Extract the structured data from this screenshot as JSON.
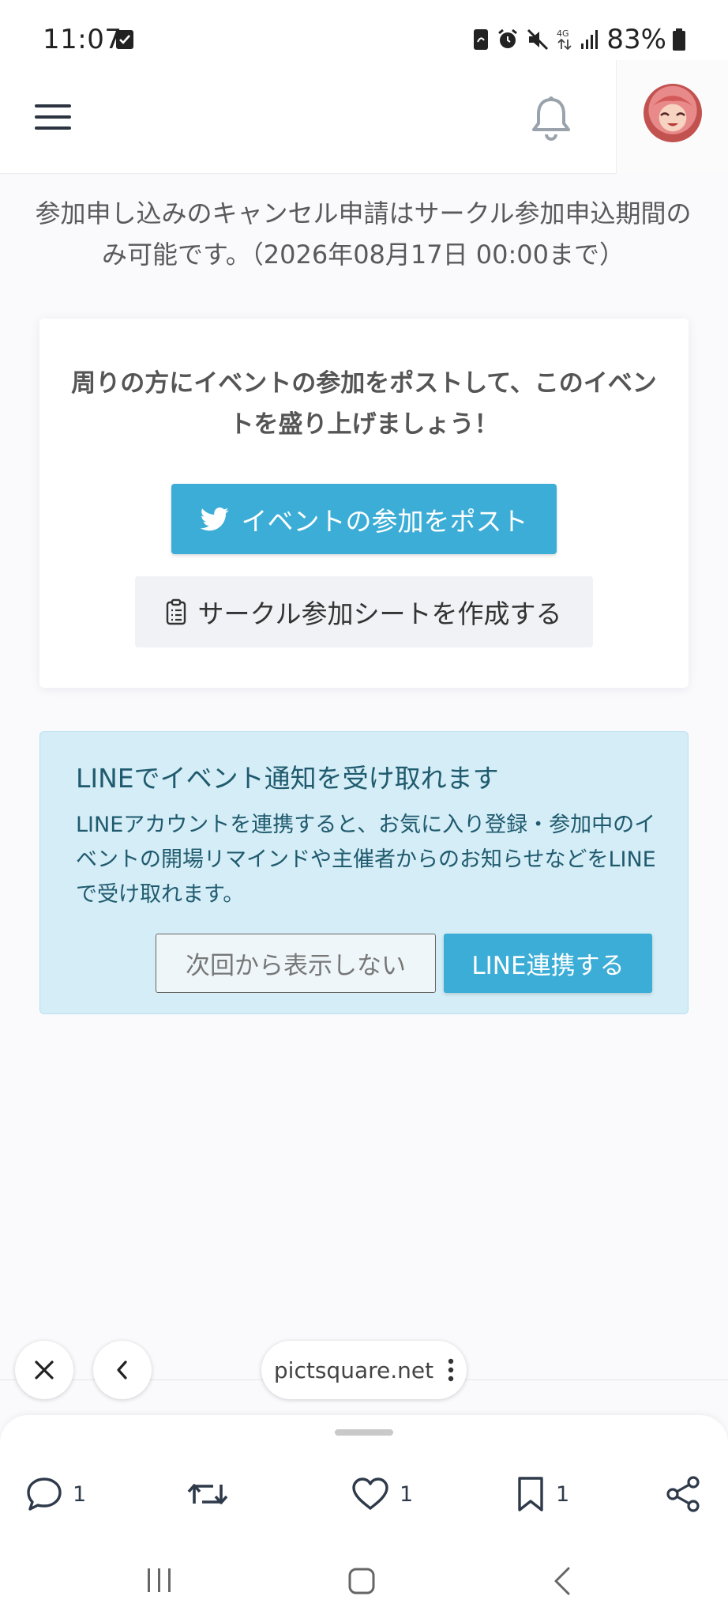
{
  "status_bar": {
    "time": "11:07",
    "battery": "83%",
    "network": "4G"
  },
  "header": {
    "menu_icon": "hamburger-menu-icon",
    "notification_icon": "bell-icon",
    "avatar_icon": "user-avatar"
  },
  "notice": {
    "cancel_text": "参加申し込みのキャンセル申請はサークル参加申込期間のみ可能です。（2026年08月17日 00:00まで）"
  },
  "share_card": {
    "prompt": "周りの方にイベントの参加をポストして、このイベントを盛り上げましょう！",
    "post_button": "イベントの参加をポスト",
    "sheet_button": "サークル参加シートを作成する"
  },
  "line_card": {
    "title": "LINEでイベント通知を受け取れます",
    "description": "LINEアカウントを連携すると、お気に入り登録・参加中のイベントの開場リマインドや主催者からのお知らせなどをLINEで受け取れます。",
    "dismiss_button": "次回から表示しない",
    "link_button": "LINE連携する"
  },
  "browser": {
    "url": "pictsquare.net"
  },
  "actions": {
    "reply_count": "1",
    "like_count": "1",
    "bookmark_count": "1"
  },
  "colors": {
    "accent": "#3badd6",
    "line_card_bg": "#d4edf6",
    "line_card_text": "#1f5a6e"
  }
}
